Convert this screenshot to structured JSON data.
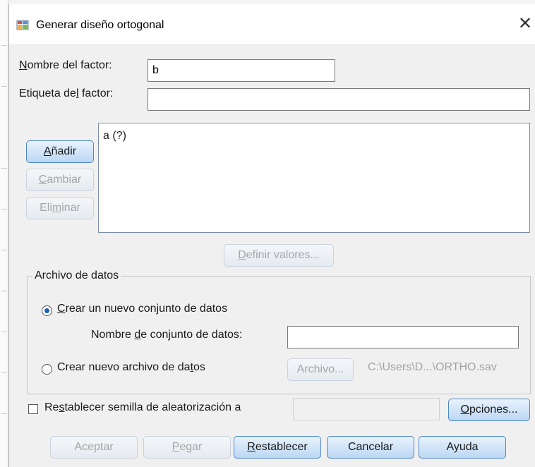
{
  "dialog": {
    "title": "Generar diseño ortogonal",
    "close": "✕",
    "icon": "spss-dialog-icon"
  },
  "factor": {
    "name_label_key": "N",
    "name_label_rest": "ombre del factor:",
    "name_value": "b",
    "label_label_pre": "Etiqueta de",
    "label_label_key": "l",
    "label_label_post": " factor:",
    "label_value": ""
  },
  "list": {
    "items": [
      "a (?)"
    ]
  },
  "side_buttons": {
    "add_key": "A",
    "add_rest": "ñadir",
    "change_key": "C",
    "change_rest": "ambiar",
    "remove_pre": "Eli",
    "remove_key": "m",
    "remove_post": "inar"
  },
  "define_values": {
    "key": "D",
    "rest": "efinir valores..."
  },
  "data_file": {
    "legend": "Archivo de datos",
    "new_dataset_key": "C",
    "new_dataset_rest": "rear un nuevo conjunto de datos",
    "dataset_name_pre": "Nombre ",
    "dataset_name_key": "d",
    "dataset_name_post": "e conjunto de datos:",
    "dataset_name_value": "",
    "new_file_pre": "Crear nuevo archivo de da",
    "new_file_key": "t",
    "new_file_post": "os",
    "file_button": "Archivo...",
    "file_path": "C:\\Users\\D...\\ORTHO.sav",
    "selected": "new_dataset"
  },
  "seed": {
    "pre": "Re",
    "key": "s",
    "post": "tablecer semilla de aleatorización a",
    "value": "",
    "checked": false
  },
  "options": {
    "key": "O",
    "rest": "pciones..."
  },
  "footer": {
    "accept": "Aceptar",
    "paste_key": "P",
    "paste_rest": "egar",
    "reset_key": "R",
    "reset_rest": "establecer",
    "cancel": "Cancelar",
    "help": "Ayuda"
  },
  "colors": {
    "accent": "#4d86c7",
    "radio_dot": "#1f5fb8",
    "disabled_text": "#a3a3a3"
  }
}
